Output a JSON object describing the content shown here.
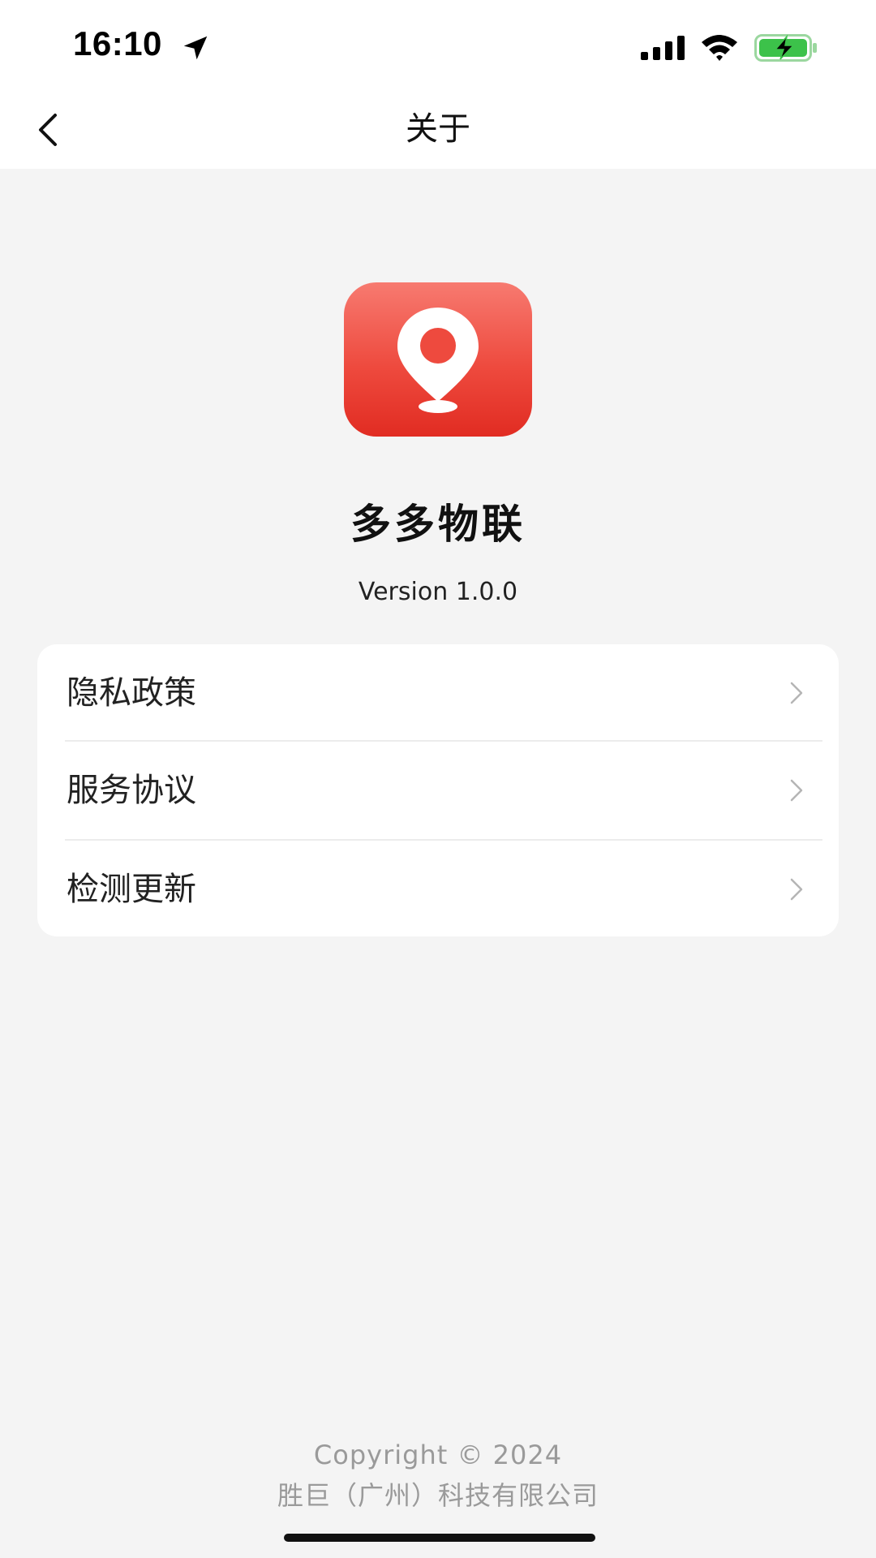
{
  "status_bar": {
    "time": "16:10",
    "battery_color": "#3cc24a"
  },
  "nav": {
    "title": "关于",
    "back_icon": "chevron-left-icon"
  },
  "app": {
    "name": "多多物联",
    "version": "Version 1.0.0",
    "logo_icon": "map-pin-icon",
    "logo_color": "#ee4a3e"
  },
  "menu": {
    "items": [
      {
        "label": "隐私政策",
        "icon": "chevron-right-icon"
      },
      {
        "label": "服务协议",
        "icon": "chevron-right-icon"
      },
      {
        "label": "检测更新",
        "icon": "chevron-right-icon"
      }
    ]
  },
  "footer": {
    "copyright": "Copyright © 2024",
    "company": "胜巨（广州）科技有限公司"
  }
}
